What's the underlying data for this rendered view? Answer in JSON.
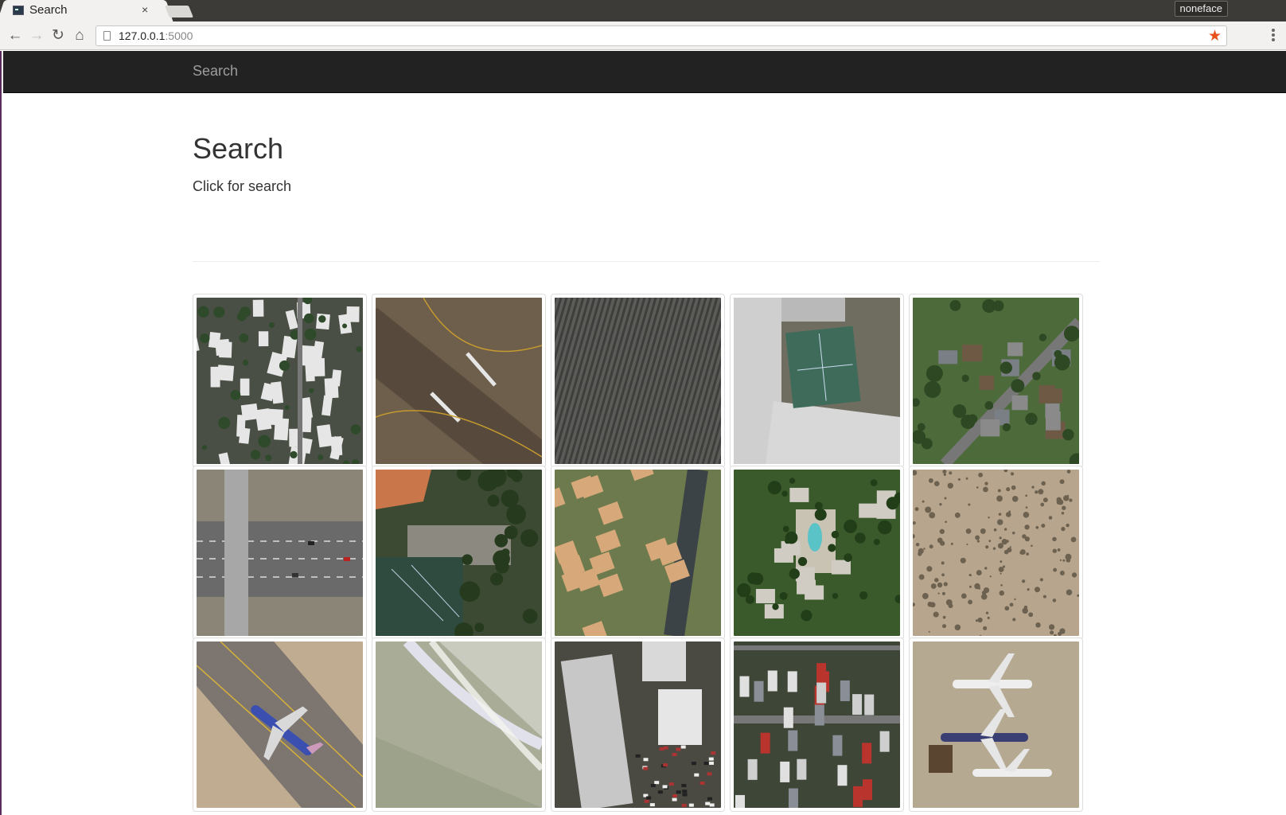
{
  "browser": {
    "tab_title": "Search",
    "tab_close": "×",
    "profile_name": "noneface",
    "url_host": "127.0.0.1",
    "url_port": ":5000"
  },
  "navbar": {
    "brand": "Search"
  },
  "header": {
    "title": "Search",
    "subtitle": "Click for search"
  },
  "thumbnails": [
    {
      "scene": "mobile-home-park",
      "rows": [
        1,
        1
      ]
    },
    {
      "scene": "runway",
      "rows": [
        1,
        2
      ]
    },
    {
      "scene": "chaparral-rows",
      "rows": [
        1,
        3
      ]
    },
    {
      "scene": "tennis-court",
      "rows": [
        1,
        4
      ]
    },
    {
      "scene": "suburban-houses",
      "rows": [
        1,
        5
      ]
    },
    {
      "scene": "freeway-overpass",
      "rows": [
        2,
        1
      ]
    },
    {
      "scene": "tennis-court-trees",
      "rows": [
        2,
        2
      ]
    },
    {
      "scene": "dense-residential",
      "rows": [
        2,
        3
      ]
    },
    {
      "scene": "apartment-pool",
      "rows": [
        2,
        4
      ]
    },
    {
      "scene": "desert-scrub",
      "rows": [
        2,
        5
      ]
    },
    {
      "scene": "airplane-runway",
      "rows": [
        3,
        1
      ]
    },
    {
      "scene": "beach-surf",
      "rows": [
        3,
        2
      ]
    },
    {
      "scene": "storage-tanks-buildings",
      "rows": [
        3,
        3
      ]
    },
    {
      "scene": "mobile-home-park-2",
      "rows": [
        3,
        4
      ]
    },
    {
      "scene": "airplanes-parked",
      "rows": [
        3,
        5
      ]
    }
  ],
  "colors": {
    "navbar": "#222222",
    "brand": "#9d9d9d",
    "star": "#e8511c"
  }
}
